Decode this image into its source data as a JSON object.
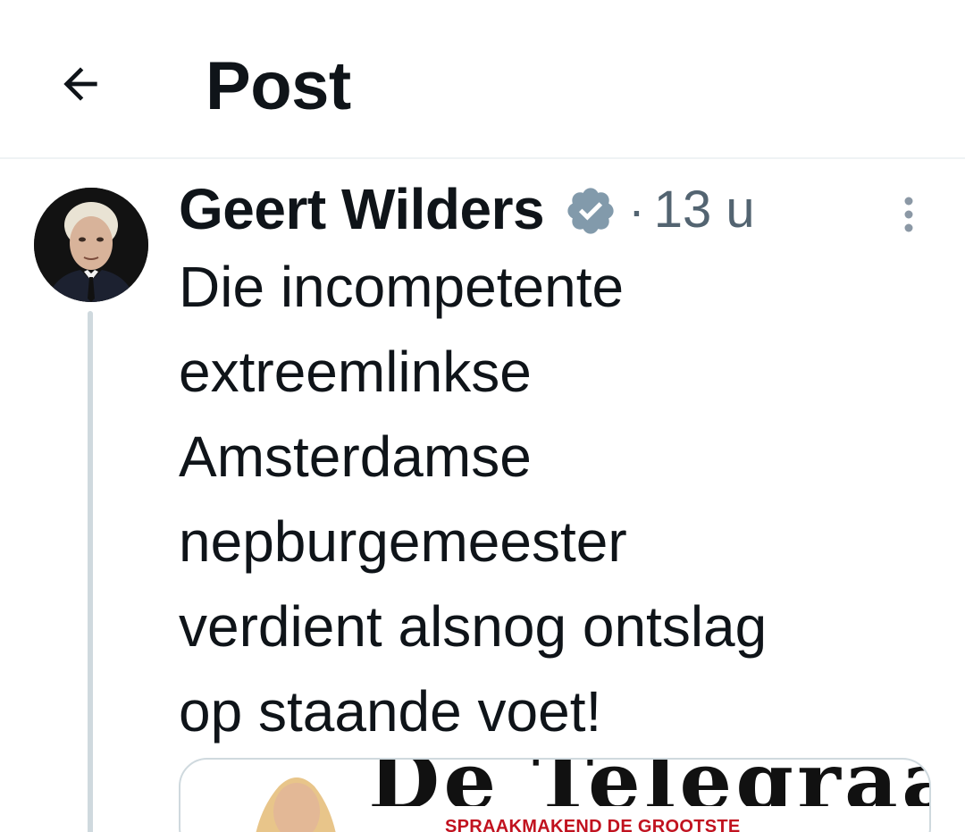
{
  "header": {
    "title": "Post",
    "back_icon": "arrow-left-icon"
  },
  "post": {
    "author": {
      "name": "Geert Wilders",
      "verified": true,
      "verified_color": "#829aab"
    },
    "separator": "·",
    "timestamp": "13 u",
    "more_icon": "more-vertical-icon",
    "text_lines": [
      "Die incompetente",
      "extreemlinkse",
      "Amsterdamse",
      "nepburgemeester",
      "verdient alsnog ontslag",
      "op staande voet!"
    ],
    "media": {
      "masthead": "De Telegraaf",
      "tagline": "SPRAAKMAKEND DE GROOTSTE",
      "tagline_color": "#c1121f"
    }
  },
  "colors": {
    "text_primary": "#0f1419",
    "text_secondary": "#536471",
    "border": "#cfd9de"
  }
}
